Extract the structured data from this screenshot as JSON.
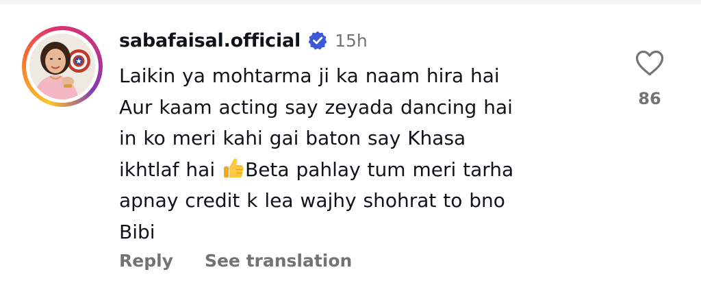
{
  "comment": {
    "username": "sabafaisal.official",
    "verified": true,
    "timestamp": "15h",
    "text_before_emoji": "Laikin ya mohtarma ji ka naam hira hai\nAur kaam acting say zeyada dancing hai\nin ko meri kahi gai baton say Khasa\nikhtlaf hai ",
    "emoji": "thumbs-up",
    "text_after_emoji": "Beta pahlay tum meri tarha\napnay credit k lea wajhy shohrat to bno\nBibi",
    "like_count": "86",
    "actions": {
      "reply_label": "Reply",
      "translate_label": "See translation"
    }
  },
  "colors": {
    "text": "#0f1419",
    "muted": "#737373",
    "verified_blue": "#3b5bdb",
    "story_ring": [
      "#f9c52f",
      "#f77f2a",
      "#e1306c",
      "#c13584",
      "#833ab4"
    ]
  },
  "icons": {
    "verified": "verified-badge-icon",
    "like": "heart-outline-icon",
    "emoji": "thumbs-up-emoji"
  }
}
